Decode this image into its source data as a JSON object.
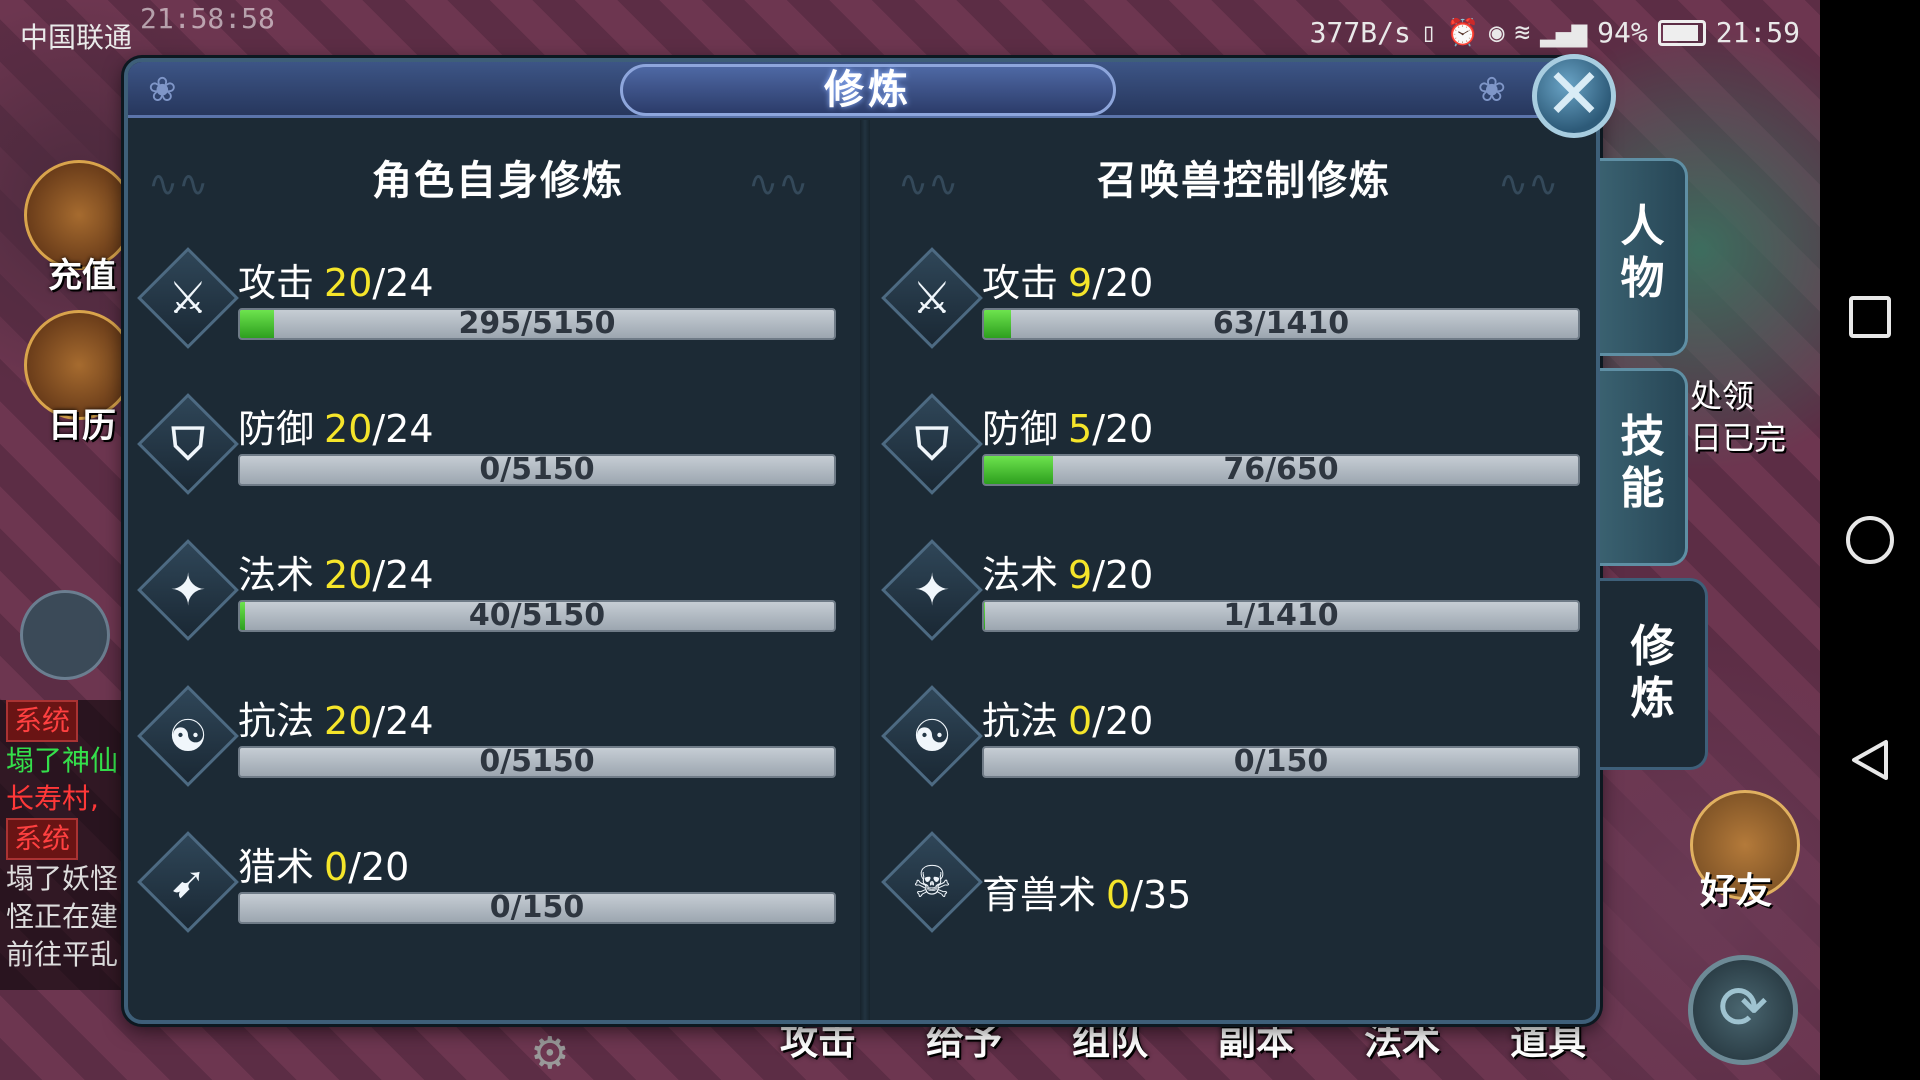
{
  "status_bar": {
    "carrier": "中国联通",
    "overlay_time": "21:58:58",
    "net_speed": "377B/s",
    "battery": "94%",
    "time": "21:59"
  },
  "hud": {
    "recharge_label": "充值",
    "calendar_label": "日历",
    "friends_label": "好友",
    "quest_text_line1": "处领",
    "quest_text_line2": "日已完"
  },
  "chat": {
    "lines": [
      {
        "tag": "系统",
        "text": ""
      },
      {
        "tag": "",
        "text": "塌了神仙"
      },
      {
        "tag": "",
        "text": "长寿村,"
      },
      {
        "tag": "系统",
        "text": ""
      },
      {
        "tag": "",
        "text": "塌了妖怪"
      },
      {
        "tag": "",
        "text": "怪正在建"
      },
      {
        "tag": "",
        "text": "前往平乱"
      }
    ]
  },
  "bottom_menu": [
    "攻击",
    "给予",
    "组队",
    "副本",
    "法术",
    "道具"
  ],
  "dialog": {
    "title": "修炼",
    "close_symbol": "✕",
    "left_section": {
      "title": "角色自身修炼",
      "rows": [
        {
          "name": "攻击",
          "level": "20",
          "max": "/24",
          "progress": "295/5150",
          "fill": 0.057,
          "icon": "sword-icon",
          "glyph": "⚔"
        },
        {
          "name": "防御",
          "level": "20",
          "max": "/24",
          "progress": "0/5150",
          "fill": 0,
          "icon": "shield-icon",
          "glyph": "⛉"
        },
        {
          "name": "法术",
          "level": "20",
          "max": "/24",
          "progress": "40/5150",
          "fill": 0.008,
          "icon": "magic-staff-icon",
          "glyph": "✦"
        },
        {
          "name": "抗法",
          "level": "20",
          "max": "/24",
          "progress": "0/5150",
          "fill": 0,
          "icon": "yin-yang-icon",
          "glyph": "☯"
        },
        {
          "name": "猎术",
          "level": "0",
          "max": "/20",
          "progress": "0/150",
          "fill": 0,
          "icon": "bow-icon",
          "glyph": "➹"
        }
      ]
    },
    "right_section": {
      "title": "召唤兽控制修炼",
      "rows": [
        {
          "name": "攻击",
          "level": "9",
          "max": "/20",
          "progress": "63/1410",
          "fill": 0.045,
          "icon": "sword-icon",
          "glyph": "⚔"
        },
        {
          "name": "防御",
          "level": "5",
          "max": "/20",
          "progress": "76/650",
          "fill": 0.117,
          "icon": "shield-icon",
          "glyph": "⛉"
        },
        {
          "name": "法术",
          "level": "9",
          "max": "/20",
          "progress": "1/1410",
          "fill": 0.001,
          "icon": "magic-staff-icon",
          "glyph": "✦"
        },
        {
          "name": "抗法",
          "level": "0",
          "max": "/20",
          "progress": "0/150",
          "fill": 0,
          "icon": "yin-yang-icon",
          "glyph": "☯"
        },
        {
          "name": "育兽术",
          "level": "0",
          "max": "/35",
          "progress": "",
          "fill": null,
          "icon": "pet-skull-icon",
          "glyph": "☠"
        }
      ]
    }
  },
  "side_tabs": [
    {
      "label": "人\n物",
      "active": false
    },
    {
      "label": "技\n能",
      "active": false
    },
    {
      "label": "修\n炼",
      "active": true
    }
  ]
}
